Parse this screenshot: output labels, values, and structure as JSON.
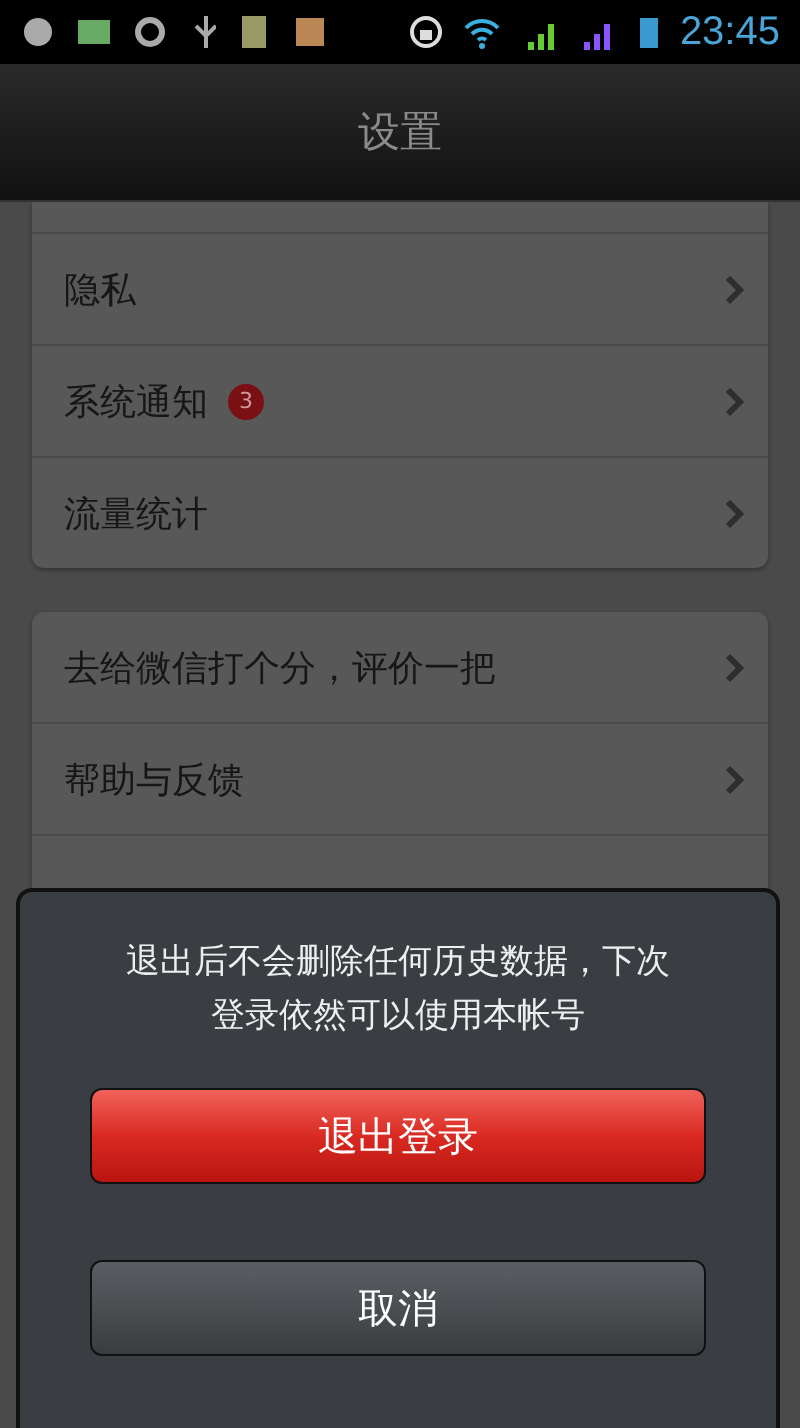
{
  "status_bar": {
    "time": "23:45"
  },
  "title_bar": {
    "title": "设置"
  },
  "groups": [
    {
      "rows": [
        {
          "label": "隐私"
        },
        {
          "label": "系统通知",
          "badge": "3"
        },
        {
          "label": "流量统计"
        }
      ]
    },
    {
      "rows": [
        {
          "label": "去给微信打个分，评价一把"
        },
        {
          "label": "帮助与反馈"
        }
      ],
      "cut_row": true
    }
  ],
  "dialog": {
    "message": "退出后不会删除任何历史数据，下次登录依然可以使用本帐号",
    "buttons": [
      {
        "label": "退出登录",
        "kind": "danger"
      },
      {
        "label": "取消",
        "kind": "normal"
      }
    ]
  }
}
